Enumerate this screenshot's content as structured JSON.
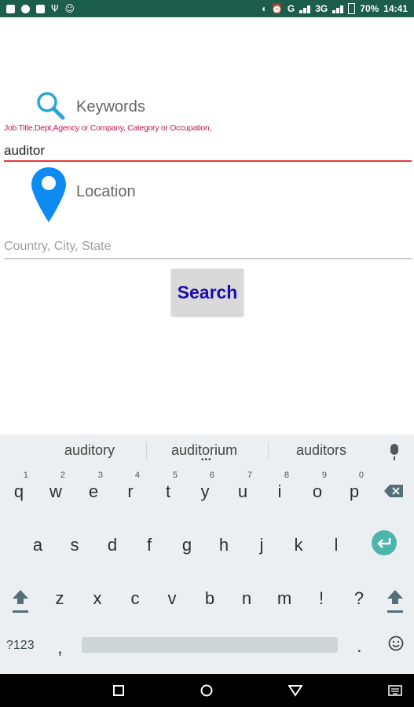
{
  "statusbar": {
    "carrier": "G",
    "network": "3G",
    "battery": "70%",
    "time": "14:41"
  },
  "keywords": {
    "label": "Keywords",
    "hint": "Job Title,Dept,Agency or Company, Category or Occupation,",
    "value": "auditor"
  },
  "location": {
    "label": "Location",
    "placeholder": "Country, City, State"
  },
  "search_button": {
    "label": "Search"
  },
  "keyboard": {
    "suggestions": [
      "auditory",
      "auditorium",
      "auditors"
    ],
    "row1": [
      {
        "k": "q",
        "n": "1"
      },
      {
        "k": "w",
        "n": "2"
      },
      {
        "k": "e",
        "n": "3"
      },
      {
        "k": "r",
        "n": "4"
      },
      {
        "k": "t",
        "n": "5"
      },
      {
        "k": "y",
        "n": "6"
      },
      {
        "k": "u",
        "n": "7"
      },
      {
        "k": "i",
        "n": "8"
      },
      {
        "k": "o",
        "n": "9"
      },
      {
        "k": "p",
        "n": "0"
      }
    ],
    "row2": [
      "a",
      "s",
      "d",
      "f",
      "g",
      "h",
      "j",
      "k",
      "l"
    ],
    "row3": [
      "z",
      "x",
      "c",
      "v",
      "b",
      "n",
      "m",
      "!",
      "?"
    ],
    "sym_label": "?123",
    "comma": ",",
    "period": "."
  },
  "colors": {
    "status_bg": "#1c5d4c",
    "accent": "#e53935",
    "hint": "#c2185b",
    "pin": "#0d8bf2",
    "enter": "#4db6ac",
    "button_text": "#1a0dab"
  }
}
